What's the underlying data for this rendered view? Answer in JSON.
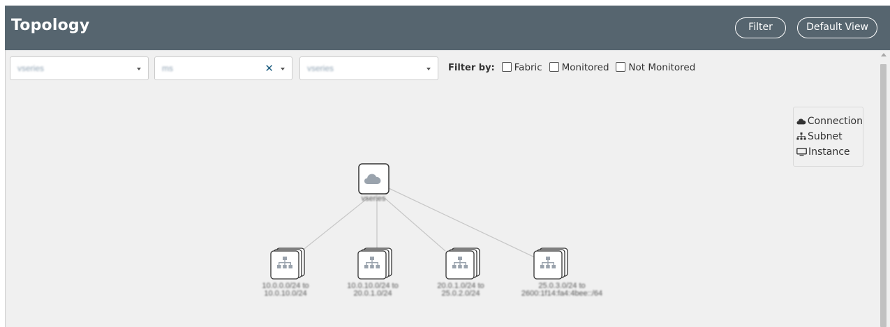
{
  "header": {
    "title": "Topology",
    "filter_button": "Filter",
    "default_view_button": "Default View"
  },
  "selects": [
    {
      "value": "vseries",
      "clearable": false
    },
    {
      "value": "ms",
      "clearable": true,
      "clear_icon": "close-icon"
    },
    {
      "value": "vseries",
      "clearable": false
    }
  ],
  "filter_by": {
    "label": "Filter by:",
    "options": [
      {
        "label": "Fabric",
        "checked": false
      },
      {
        "label": "Monitored",
        "checked": false
      },
      {
        "label": "Not Monitored",
        "checked": false
      }
    ]
  },
  "legend": [
    {
      "label": "Connection",
      "icon": "cloud-icon"
    },
    {
      "label": "Subnet",
      "icon": "sitemap-icon"
    },
    {
      "label": "Instance",
      "icon": "desktop-icon"
    }
  ],
  "graph": {
    "root": {
      "label": "vseries",
      "icon": "cloud-icon"
    },
    "children": [
      {
        "label_line1": "10.0.0.0/24 to",
        "label_line2": "10.0.10.0/24",
        "icon": "sitemap-icon"
      },
      {
        "label_line1": "10.0.10.0/24 to",
        "label_line2": "20.0.1.0/24",
        "icon": "sitemap-icon"
      },
      {
        "label_line1": "20.0.1.0/24 to",
        "label_line2": "25.0.2.0/24",
        "icon": "sitemap-icon"
      },
      {
        "label_line1": "25.0.3.0/24 to",
        "label_line2": "2600:1f14:fa4:4bee::/64",
        "icon": "sitemap-icon"
      }
    ]
  },
  "colors": {
    "header_bg": "#56656f",
    "canvas_bg": "#f0f0f0",
    "icon_gray": "#9aa3ad",
    "clear_x": "#1f5e80"
  }
}
